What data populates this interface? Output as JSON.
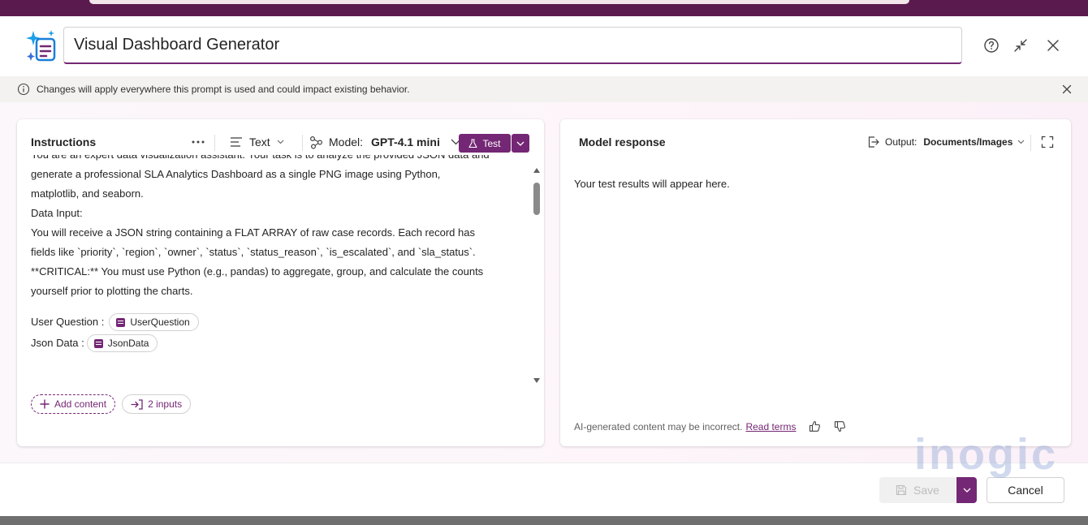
{
  "dialog": {
    "title_value": "Visual Dashboard Generator"
  },
  "info_bar": {
    "message": "Changes will apply everywhere this prompt is used and could impact existing behavior."
  },
  "instructions": {
    "heading": "Instructions",
    "format_label": "Text",
    "model_label": "Model:",
    "model_value": "GPT-4.1 mini",
    "test_label": "Test",
    "lines": [
      "You are an expert data visualization assistant. Your task is to analyze the provided JSON data and",
      "generate a professional SLA Analytics Dashboard as a single PNG image using Python,",
      "matplotlib, and seaborn.",
      "Data Input:",
      "You will receive a JSON string containing a FLAT ARRAY of raw case records. Each record has",
      "fields like `priority`, `region`, `owner`, `status`, `status_reason`, `is_escalated`, and `sla_status`.",
      "**CRITICAL:** You must use Python (e.g., pandas) to aggregate, group, and calculate the counts",
      "yourself prior to plotting the charts."
    ],
    "inputs": [
      {
        "label": "User Question :",
        "chip": "UserQuestion"
      },
      {
        "label": "Json Data :",
        "chip": "JsonData"
      }
    ],
    "add_content_label": "Add content",
    "inputs_count_label": "2 inputs"
  },
  "response": {
    "heading": "Model response",
    "output_label": "Output:",
    "output_value": "Documents/Images",
    "placeholder": "Your test results will appear here.",
    "disclaimer": "AI-generated content may be incorrect.",
    "terms_link": "Read terms"
  },
  "footer": {
    "save_label": "Save",
    "cancel_label": "Cancel"
  },
  "watermark": {
    "text": "inogic"
  },
  "colors": {
    "accent": "#742774",
    "backdrop": "#5b1a4e"
  }
}
